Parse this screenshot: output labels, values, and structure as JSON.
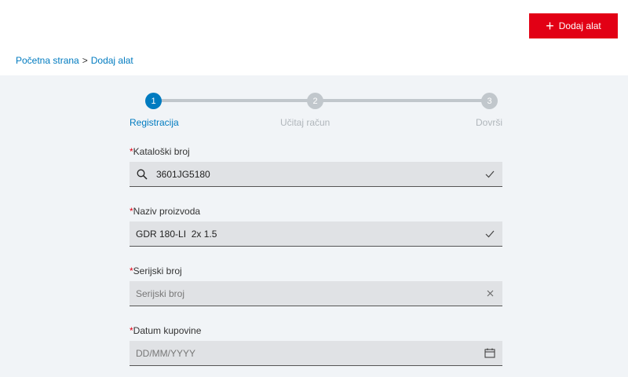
{
  "header": {
    "add_tool_label": "Dodaj alat"
  },
  "breadcrumb": {
    "home": "Početna strana",
    "separator": ">",
    "current": "Dodaj alat"
  },
  "stepper": {
    "steps": [
      {
        "number": "1",
        "label": "Registracija",
        "active": true
      },
      {
        "number": "2",
        "label": "Učitaj račun",
        "active": false
      },
      {
        "number": "3",
        "label": "Dovrši",
        "active": false
      }
    ]
  },
  "form": {
    "catalog": {
      "required_mark": "*",
      "label": "Kataloški broj",
      "value": "3601JG5180",
      "placeholder": "",
      "status_icon": "check-icon"
    },
    "product_name": {
      "required_mark": "*",
      "label": "Naziv proizvoda",
      "value": "GDR 180-LI  2x 1.5",
      "placeholder": "",
      "status_icon": "check-icon"
    },
    "serial": {
      "required_mark": "*",
      "label": "Serijski broj",
      "value": "",
      "placeholder": "Serijski broj",
      "status_icon": "clear-icon"
    },
    "purchase_date": {
      "required_mark": "*",
      "label": "Datum kupovine",
      "value": "",
      "placeholder": "DD/MM/YYYY",
      "status_icon": "calendar-icon"
    }
  },
  "colors": {
    "brand_red": "#e20015",
    "accent_blue": "#007bc0",
    "inactive_gray": "#c1c7cc"
  }
}
